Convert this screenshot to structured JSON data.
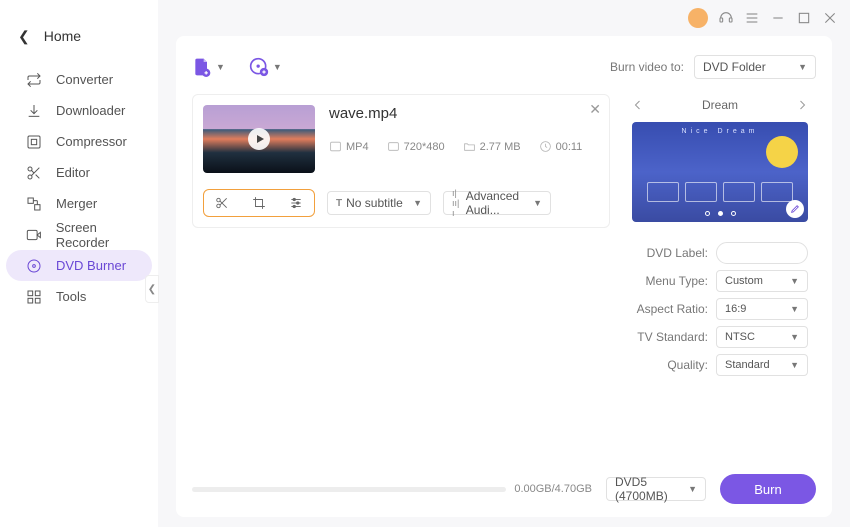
{
  "sidebar": {
    "home": "Home",
    "items": [
      {
        "key": "converter",
        "label": "Converter"
      },
      {
        "key": "downloader",
        "label": "Downloader"
      },
      {
        "key": "compressor",
        "label": "Compressor"
      },
      {
        "key": "editor",
        "label": "Editor"
      },
      {
        "key": "merger",
        "label": "Merger"
      },
      {
        "key": "screen-recorder",
        "label": "Screen Recorder"
      },
      {
        "key": "dvd-burner",
        "label": "DVD Burner"
      },
      {
        "key": "tools",
        "label": "Tools"
      }
    ],
    "active": "dvd-burner"
  },
  "header": {
    "burn_to_label": "Burn video to:",
    "burn_to_value": "DVD Folder"
  },
  "video": {
    "filename": "wave.mp4",
    "format": "MP4",
    "resolution": "720*480",
    "filesize": "2.77 MB",
    "duration": "00:11",
    "subtitle_value": "No subtitle",
    "audio_value": "Advanced Audi..."
  },
  "menu": {
    "title": "Dream",
    "preview_text": "Nice Dream"
  },
  "form": {
    "dvd_label_label": "DVD Label:",
    "dvd_label_value": "",
    "menu_type_label": "Menu Type:",
    "menu_type_value": "Custom",
    "aspect_label": "Aspect Ratio:",
    "aspect_value": "16:9",
    "tv_label": "TV Standard:",
    "tv_value": "NTSC",
    "quality_label": "Quality:",
    "quality_value": "Standard"
  },
  "footer": {
    "progress_text": "0.00GB/4.70GB",
    "disc_value": "DVD5 (4700MB)",
    "burn_label": "Burn"
  }
}
